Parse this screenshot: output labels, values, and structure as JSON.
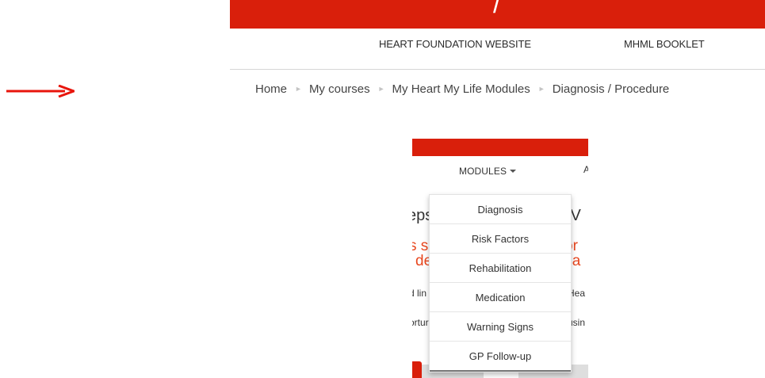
{
  "top_nav": {
    "links": [
      "HEART FOUNDATION WEBSITE",
      "MHML BOOKLET"
    ]
  },
  "breadcrumb": {
    "items": [
      "Home",
      "My courses",
      "My Heart My Life Modules",
      "Diagnosis / Procedure"
    ],
    "separator": "►"
  },
  "inner_screen": {
    "modules_label": "MODULES",
    "cut_text": {
      "cut_a": "A",
      "big_left": "eps",
      "big_right": "OV",
      "orange1_left": "s s",
      "orange1_right": "or",
      "orange2_left": "de",
      "orange2_right": "ica",
      "small1_left": "d lin",
      "small1_right": "Hea",
      "small2_left": "ortur",
      "small2_right": "usin"
    },
    "dropdown_items": [
      "Diagnosis",
      "Risk Factors",
      "Rehabilitation",
      "Medication",
      "Warning Signs",
      "GP Follow-up"
    ]
  },
  "colors": {
    "brand_red": "#d91f0b",
    "accent_orange": "#e8471f",
    "arrow_red": "#e8150c"
  },
  "icons": {
    "pointer_arrow": "right-arrow-icon",
    "breadcrumb_separator": "triangle-right-icon",
    "modules_caret": "caret-down-icon"
  }
}
